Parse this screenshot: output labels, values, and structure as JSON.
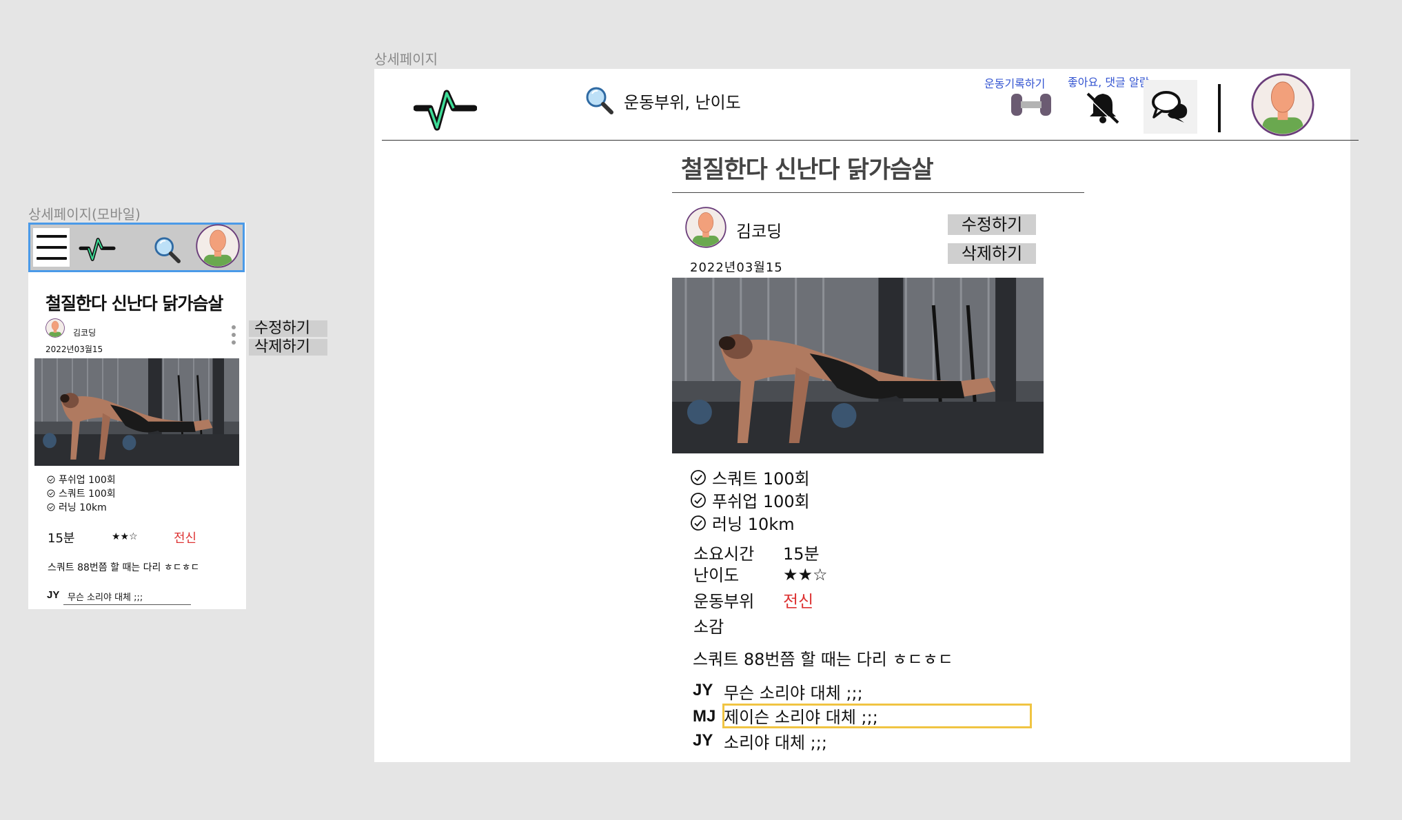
{
  "mobile": {
    "frame_label": "상세페이지(모바일)",
    "post": {
      "title": "철질한다 신난다 닭가슴살",
      "author": "김코딩",
      "date": "2022년03월15",
      "edit_label": "수정하기",
      "delete_label": "삭제하기",
      "exercises": [
        "푸쉬업 100회",
        "스쿼트 100회",
        "러닝 10km"
      ],
      "duration": "15분",
      "difficulty": "★★☆",
      "body_part": "전신",
      "review": "스쿼트 88번쯤 할 때는 다리 ㅎㄷㅎㄷ"
    },
    "comments": [
      {
        "user": "JY",
        "text": "무슨 소리야 대체 ;;;"
      }
    ]
  },
  "desktop": {
    "frame_label": "상세페이지",
    "header": {
      "search_text": "운동부위, 난이도",
      "record_label": "운동기록하기",
      "alarm_label": "좋아요, 댓글 알람"
    },
    "post": {
      "title": "철질한다 신난다 닭가슴살",
      "author": "김코딩",
      "date": "2022년03월15",
      "edit_label": "수정하기",
      "delete_label": "삭제하기",
      "exercises": [
        "스쿼트 100회",
        "푸쉬업 100회",
        "러닝 10km"
      ],
      "time_key": "소요시간",
      "time_value": "15분",
      "difficulty_key": "난이도",
      "difficulty_value": "★★☆",
      "part_key": "운동부위",
      "part_value": "전신",
      "review_key": "소감",
      "review": "스쿼트 88번쯤 할 때는 다리 ㅎㄷㅎㄷ"
    },
    "comments": [
      {
        "user": "JY",
        "text": "무슨 소리야 대체 ;;;"
      },
      {
        "user": "MJ",
        "text": "제이슨 소리야 대체 ;;;"
      },
      {
        "user": "JY",
        "text": "소리야 대체 ;;;"
      }
    ]
  },
  "colors": {
    "accent_link": "#3354d1",
    "highlight_red": "#dd3333",
    "focus_yellow": "#f0c442",
    "mobile_focus_blue": "#4a9ae8",
    "logo_green": "#3ddc97"
  },
  "icons": [
    "pulse-logo-icon",
    "search-icon",
    "dumbbell-icon",
    "bell-muted-icon",
    "chat-bubbles-icon",
    "avatar-icon",
    "menu-icon",
    "check-circle-icon",
    "kebab-menu-icon"
  ]
}
